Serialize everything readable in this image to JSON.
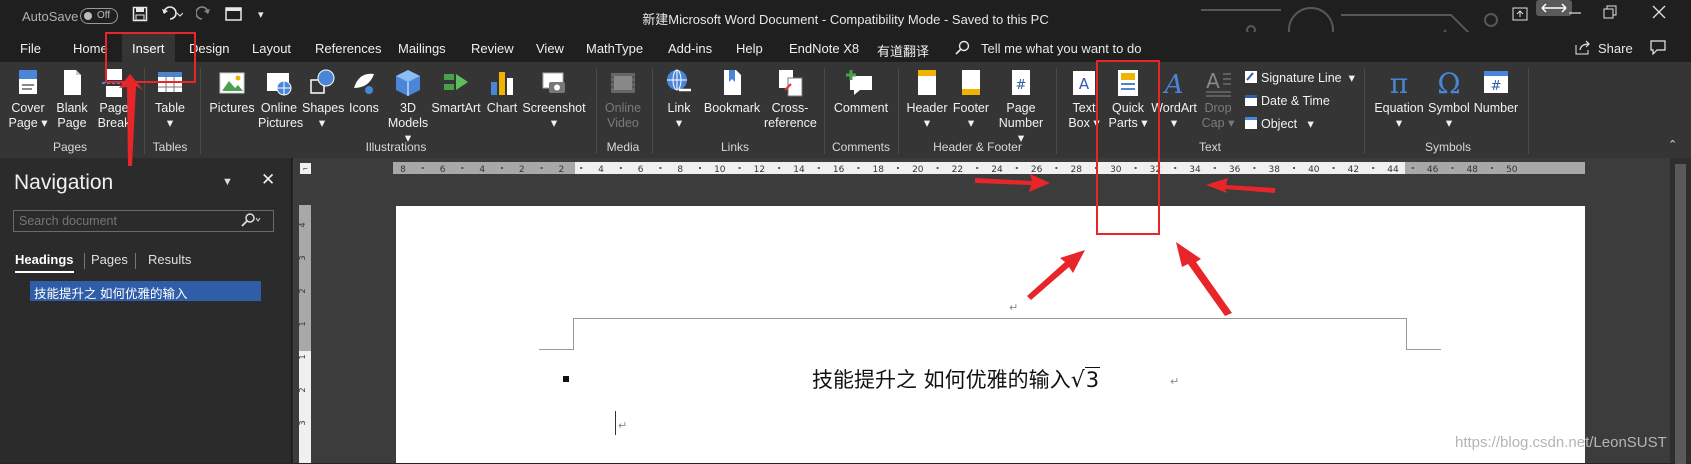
{
  "titlebar": {
    "autosave": "AutoSave",
    "autosave_state": "Off",
    "document_title": "新建Microsoft Word Document  -  Compatibility Mode  -  Saved to this PC"
  },
  "menu": {
    "tabs": [
      "File",
      "Home",
      "Insert",
      "Design",
      "Layout",
      "References",
      "Mailings",
      "Review",
      "View",
      "MathType",
      "Add-ins",
      "Help",
      "EndNote X8",
      "有道翻译"
    ],
    "active_tab": "Insert",
    "tell_me": "Tell me what you want to do",
    "share": "Share"
  },
  "ribbon": {
    "pages": {
      "label": "Pages",
      "cover_page": "Cover Page",
      "blank_page": "Blank Page",
      "page_break": "Page Break"
    },
    "tables": {
      "label": "Tables",
      "table": "Table"
    },
    "illustrations": {
      "label": "Illustrations",
      "pictures": "Pictures",
      "online_pictures": "Online Pictures",
      "shapes": "Shapes",
      "icons": "Icons",
      "models_3d": "3D Models",
      "smartart": "SmartArt",
      "chart": "Chart",
      "screenshot": "Screenshot"
    },
    "media": {
      "label": "Media",
      "online_video": "Online Video"
    },
    "links": {
      "label": "Links",
      "link": "Link",
      "bookmark": "Bookmark",
      "cross_reference": "Cross-reference"
    },
    "comments": {
      "label": "Comments",
      "comment": "Comment"
    },
    "header_footer": {
      "label": "Header & Footer",
      "header": "Header",
      "footer": "Footer",
      "page_number": "Page Number"
    },
    "text": {
      "label": "Text",
      "text_box": "Text Box",
      "quick_parts": "Quick Parts",
      "wordart": "WordArt",
      "drop_cap": "Drop Cap",
      "signature_line": "Signature Line",
      "date_time": "Date & Time",
      "object": "Object"
    },
    "symbols": {
      "label": "Symbols",
      "equation": "Equation",
      "symbol": "Symbol",
      "number": "Number"
    }
  },
  "navigation": {
    "title": "Navigation",
    "search_placeholder": "Search document",
    "tabs": [
      "Headings",
      "Pages",
      "Results"
    ],
    "headings": [
      "技能提升之  如何优雅的输入"
    ]
  },
  "ruler": {
    "h_ticks": [
      "8",
      "6",
      "4",
      "2",
      "2",
      "4",
      "6",
      "8",
      "10",
      "12",
      "14",
      "16",
      "18",
      "20",
      "22",
      "24",
      "26",
      "28",
      "30",
      "32",
      "34",
      "36",
      "38",
      "40",
      "42",
      "44",
      "46",
      "48",
      "50"
    ],
    "v_ticks": [
      "4",
      "3",
      "2",
      "1",
      "1",
      "2",
      "3"
    ]
  },
  "document": {
    "heading_text": "技能提升之    如何优雅的输入",
    "sqrt_value": "3",
    "para_mark": "↵"
  },
  "watermark": "https://blog.csdn.net/LeonSUST",
  "colors": {
    "annotation_red": "#e8262a",
    "nav_highlight": "#2f5da8"
  }
}
